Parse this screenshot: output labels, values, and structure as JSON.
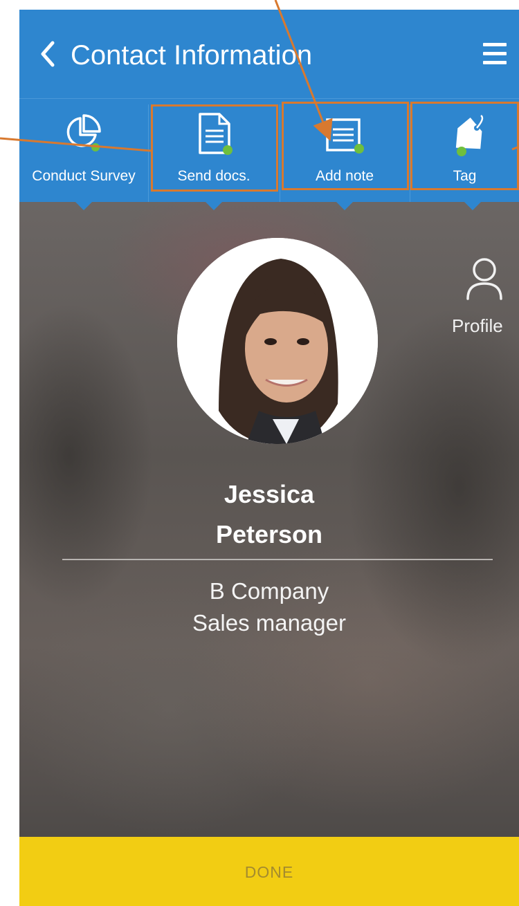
{
  "app": {
    "title": "Contact Information"
  },
  "toolbar": {
    "items": [
      {
        "label": "Conduct Survey",
        "icon": "pie-chart-icon"
      },
      {
        "label": "Send docs.",
        "icon": "document-icon"
      },
      {
        "label": "Add note",
        "icon": "notepad-icon"
      },
      {
        "label": "Tag",
        "icon": "tag-icon"
      }
    ]
  },
  "side_action": {
    "label": "Profile",
    "icon": "person-icon"
  },
  "contact": {
    "first_name": "Jessica",
    "last_name": "Peterson",
    "company": "B Company",
    "job_title": "Sales manager"
  },
  "footer": {
    "done_label": "DONE"
  },
  "colors": {
    "header": "#2e86cf",
    "done_bar": "#f2cd13",
    "callout": "#d8792f"
  }
}
